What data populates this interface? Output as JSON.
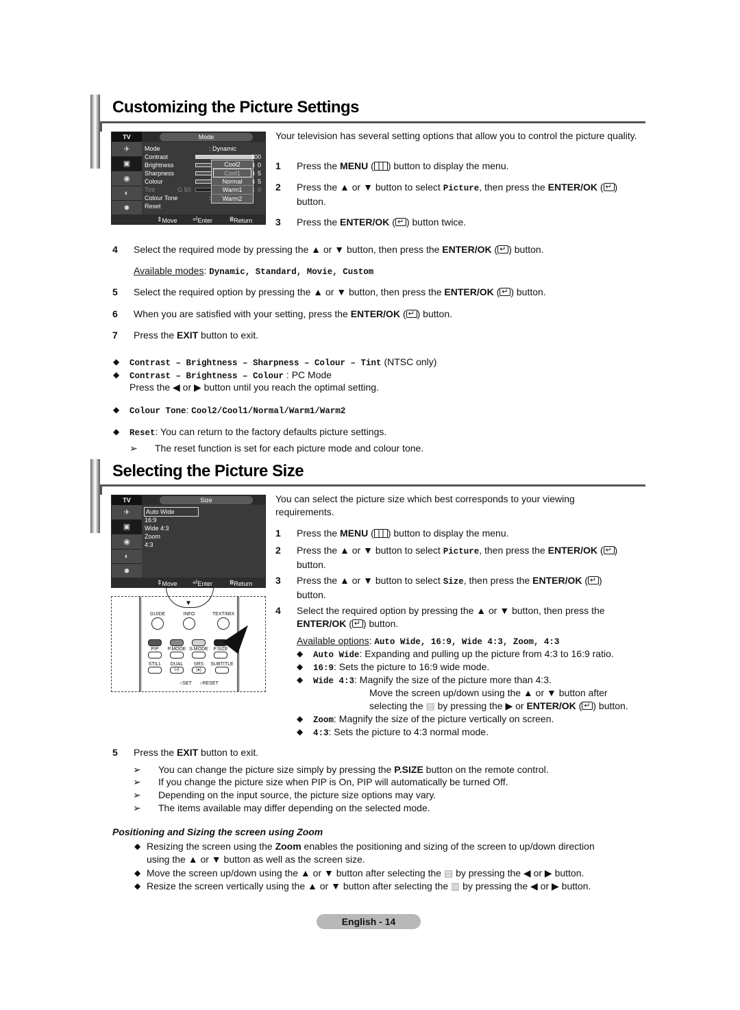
{
  "section1": {
    "title": "Customizing the Picture Settings",
    "intro": "Your television has several setting options that allow you to control the picture quality.",
    "osd": {
      "tv_label": "TV",
      "title": "Mode",
      "rows": [
        {
          "label": "Mode",
          "value": ": Dynamic"
        },
        {
          "label": "Contrast",
          "number": "100",
          "bar_level": 1.0
        },
        {
          "label": "Brightness",
          "number": "0"
        },
        {
          "label": "Sharpness",
          "number": "5"
        },
        {
          "label": "Colour",
          "number": "5"
        },
        {
          "label": "Tint",
          "prefix": "G 50",
          "number": "0",
          "disabled": true
        },
        {
          "label": "Colour Tone",
          "value": ":"
        },
        {
          "label": "Reset"
        }
      ],
      "tone_options": [
        "Cool2",
        "Cool1",
        "Normal",
        "Warm1",
        "Warm2"
      ],
      "tone_selected": "Cool1",
      "footer": {
        "move": "Move",
        "enter": "Enter",
        "return": "Return"
      }
    },
    "steps_right": [
      {
        "n": "1",
        "pre": "Press the ",
        "bold": "MENU",
        "post": " button to display the menu."
      },
      {
        "n": "2",
        "pre": "Press the ▲ or ▼ button to select ",
        "mono": "Picture",
        "mid": ", then press the ",
        "bold": "ENTER/OK",
        "post": " button."
      },
      {
        "n": "3",
        "pre": "Press the ",
        "bold": "ENTER/OK",
        "post": " button twice."
      }
    ],
    "step4": {
      "n": "4",
      "pre": "Select the required mode by pressing the ▲ or ▼ button, then press the ",
      "bold": "ENTER/OK",
      "post": " button."
    },
    "modes_label": "Available modes",
    "modes": "Dynamic, Standard, Movie, Custom",
    "step5": {
      "n": "5",
      "pre": "Select the required option by pressing the ▲ or ▼ button, then press the ",
      "bold": "ENTER/OK",
      "post": " button."
    },
    "step6": {
      "n": "6",
      "pre": "When you are satisfied with your setting, press the ",
      "bold": "ENTER/OK",
      "post": " button."
    },
    "step7": {
      "n": "7",
      "pre": "Press the ",
      "bold": "EXIT",
      "post": " button to exit."
    },
    "bullet1_mono": "Contrast – Brightness – Sharpness – Colour – Tint",
    "bullet1_text": " (NTSC only)",
    "bullet2_mono": "Contrast – Brightness  – Colour",
    "bullet2_text": " : PC Mode",
    "bullet2_sub": "Press the ◀ or ▶ button until you reach the optimal setting.",
    "bullet3_mono": "Colour Tone",
    "bullet3_values": "Cool2/Cool1/Normal/Warm1/Warm2",
    "bullet4_mono": "Reset",
    "bullet4_text": ": You can return to the factory defaults picture settings.",
    "note": "The reset function is set for each picture mode and colour tone."
  },
  "section2": {
    "title": "Selecting the Picture Size",
    "intro": "You can select the picture size which best corresponds to your viewing requirements.",
    "osd": {
      "tv_label": "TV",
      "title": "Size",
      "items": [
        "Auto Wide",
        "16:9",
        "Wide 4:3",
        "Zoom",
        "4:3"
      ],
      "selected": "Auto Wide",
      "footer": {
        "move": "Move",
        "enter": "Enter",
        "return": "Return"
      }
    },
    "remote": {
      "top_labels": [
        "GUIDE",
        "INFO",
        "TEXT/MIX"
      ],
      "mid_labels": [
        "PIP",
        "P.MODE",
        "S.MODE",
        "P.SIZE"
      ],
      "bottom_labels": [
        "STILL",
        "DUAL",
        "SRS",
        "SUBTITLE"
      ],
      "dual_glyph": "I-II",
      "srs_glyph": "(●)",
      "set_label": "SET",
      "reset_label": "RESET",
      "color_keys": [
        "#555555",
        "#888888",
        "#d0d0d0",
        "#222222"
      ]
    },
    "steps": [
      {
        "n": "1",
        "pre": "Press the ",
        "bold": "MENU",
        "post": " button to display the menu."
      },
      {
        "n": "2",
        "pre": "Press the ▲ or ▼ button to select ",
        "mono": "Picture",
        "mid": ", then press the ",
        "bold": "ENTER/OK",
        "post": ""
      },
      {
        "n": "3",
        "pre": "Press the ▲ or ▼ button to select ",
        "mono": "Size",
        "mid": ", then press the ",
        "bold": "ENTER/OK",
        "post": ""
      },
      {
        "n": "4",
        "pre": "Select the required option by pressing the ▲ or ▼ button, then press the",
        "bold": "ENTER/OK",
        "post": " button."
      }
    ],
    "button_word": "button.",
    "options_label": "Available options",
    "options": "Auto Wide, 16:9, Wide 4:3, Zoom, 4:3",
    "option_bullets": [
      {
        "mono": "Auto Wide",
        "text": ": Expanding and pulling up the picture from 4:3 to 16:9 ratio."
      },
      {
        "mono": "16:9",
        "text": ": Sets the picture to 16:9 wide mode."
      },
      {
        "mono": "Wide 4:3",
        "text": ": Magnify the size of the picture more than 4:3."
      },
      {
        "mono": "Zoom",
        "text": ": Magnify the size of the picture vertically on screen."
      },
      {
        "mono": "4:3",
        "text": ": Sets the picture to 4:3 normal mode."
      }
    ],
    "wide_extra1": "Move the screen up/down using the ▲ or ▼ button after",
    "wide_extra2_pre": "selecting the",
    "wide_extra2_post": "by pressing the ▶ or ",
    "wide_extra2_bold": "ENTER/OK",
    "wide_extra2_end": " button.",
    "step5": {
      "n": "5",
      "pre": "Press the ",
      "bold": "EXIT",
      "post": " button to exit."
    },
    "notes": [
      {
        "pre": "You can change the picture size simply by pressing the ",
        "bold": "P.SIZE",
        "post": " button on the remote control."
      },
      {
        "pre": "If you change the picture size when PIP is On, PIP will automatically be turned Off."
      },
      {
        "pre": "Depending on the input source, the picture size options may vary."
      },
      {
        "pre": "The items available may differ depending on the selected mode."
      }
    ],
    "zoom_heading": "Positioning and Sizing the screen using Zoom",
    "zoom_bullets": [
      {
        "pre": "Resizing the screen using the ",
        "bold": "Zoom",
        "post": " enables the positioning and sizing of the screen to up/down direction",
        "line2": "using the ▲ or ▼ button as well as the screen size."
      },
      {
        "pre": "Move the screen up/down using the ▲ or ▼ button after selecting the",
        "post": "by pressing the ◀ or ▶ button."
      },
      {
        "pre": "Resize the screen vertically using the ▲ or ▼ button after selecting the",
        "post": "by pressing the ◀ or ▶ button."
      }
    ]
  },
  "footer": {
    "page_label": "English - 14"
  }
}
